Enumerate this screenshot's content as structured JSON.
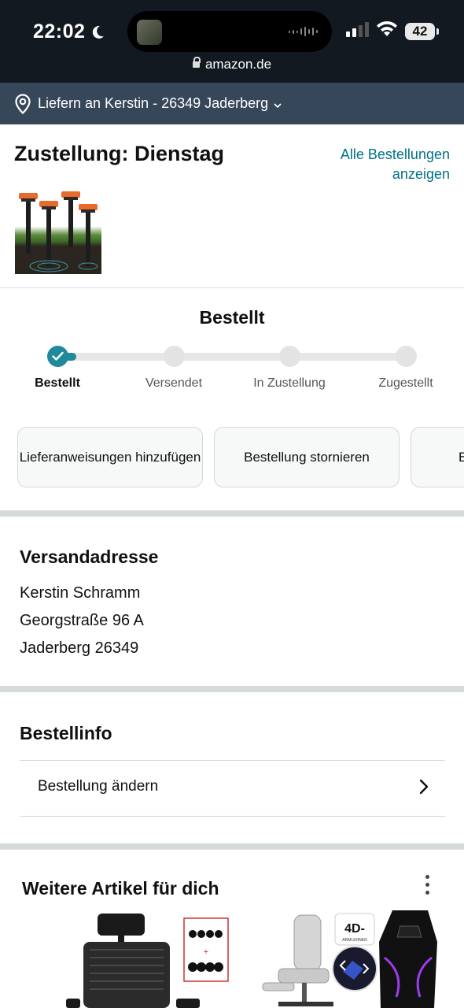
{
  "status_bar": {
    "time": "22:02",
    "battery": "42",
    "url": "amazon.de"
  },
  "delivery_bar": {
    "text": "Liefern an Kerstin - 26349 Jaderberg"
  },
  "order_header": {
    "title": "Zustellung: Dienstag",
    "all_orders_link": "Alle Bestellungen anzeigen"
  },
  "tracker": {
    "status_title": "Bestellt",
    "steps": [
      {
        "label": "Bestellt",
        "active": true
      },
      {
        "label": "Versendet",
        "active": false
      },
      {
        "label": "In Zustellung",
        "active": false
      },
      {
        "label": "Zugestellt",
        "active": false
      }
    ],
    "progress_fraction": 0.0
  },
  "actions": [
    {
      "label": "Lieferanweisungen hinzufügen"
    },
    {
      "label": "Bestellung stornieren"
    },
    {
      "label": "B"
    }
  ],
  "shipping_address": {
    "heading": "Versandadresse",
    "name": "Kerstin Schramm",
    "street": "Georgstraße 96 A",
    "city": "Jaderberg 26349"
  },
  "order_info": {
    "heading": "Bestellinfo",
    "change_order": "Bestellung ändern"
  },
  "recommendations": {
    "heading": "Weitere Artikel für dich",
    "badge_text": "4D-",
    "badge_subtext": "ARMLEHNEN"
  },
  "colors": {
    "header_bg": "#131921",
    "delivery_bar_bg": "#37475a",
    "link": "#007185",
    "progress": "#1e8a9b",
    "separator": "#d5dbdb"
  }
}
